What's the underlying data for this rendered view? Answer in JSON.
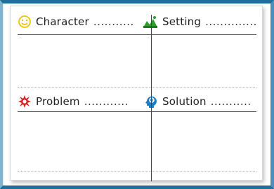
{
  "worksheet": {
    "panels": [
      {
        "label": "Character",
        "dots": "...........",
        "icon": "smiley-icon"
      },
      {
        "label": "Setting",
        "dots": "..............",
        "icon": "landscape-icon"
      },
      {
        "label": "Problem",
        "dots": "............",
        "icon": "burst-icon"
      },
      {
        "label": "Solution",
        "dots": "...........",
        "icon": "head-gear-icon"
      }
    ]
  },
  "colors": {
    "frame_border": "#1f6f96",
    "smiley": "#f2c200",
    "landscape": "#2e9e2e",
    "burst": "#e02020",
    "head_gear": "#1e7fc4"
  }
}
